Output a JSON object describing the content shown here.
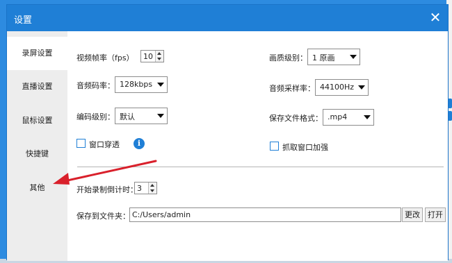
{
  "dialog": {
    "title": "设置"
  },
  "sidebar": {
    "items": [
      {
        "label": "录屏设置"
      },
      {
        "label": "直播设置"
      },
      {
        "label": "鼠标设置"
      },
      {
        "label": "快捷键"
      },
      {
        "label": "其他"
      }
    ]
  },
  "settings": {
    "fps_label": "视频帧率（fps）",
    "fps_value": "10",
    "quality_label": "画质级别：",
    "quality_value": "1 原画",
    "audio_bitrate_label": "音频码率：",
    "audio_bitrate_value": "128kbps",
    "sample_rate_label": "音频采样率：",
    "sample_rate_value": "44100Hz",
    "encode_level_label": "编码级别：",
    "encode_level_value": "默认",
    "format_label": "保存文件格式：",
    "format_value": ".mp4",
    "window_through_label": "窗口穿透",
    "capture_accel_label": "抓取窗口加强",
    "countdown_label": "开始录制倒计时：",
    "countdown_value": "3",
    "save_folder_label": "保存到文件夹：",
    "save_folder_value": "C:/Users/admin",
    "change_button": "更改",
    "open_button": "打开"
  },
  "colors": {
    "accent": "#1f7fd6",
    "annotation_arrow": "#d9202b"
  }
}
